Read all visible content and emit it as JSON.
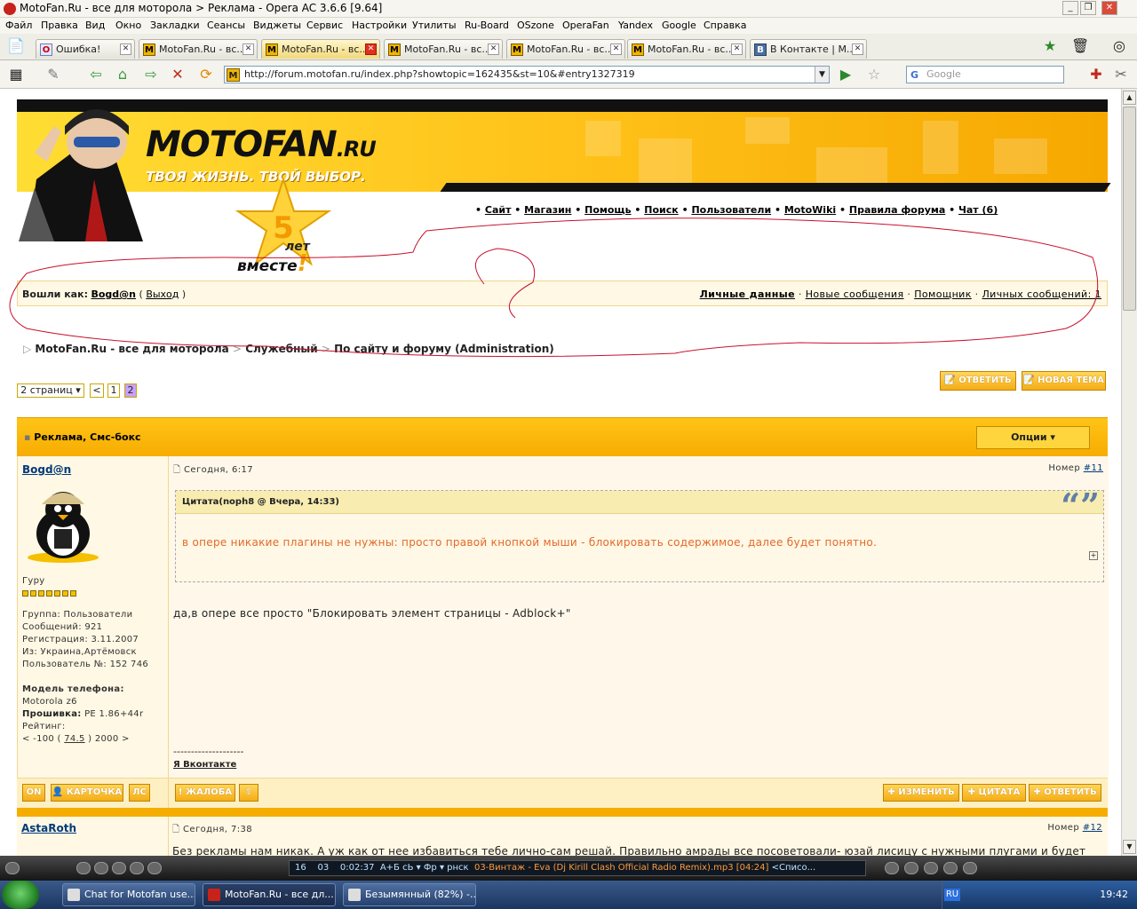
{
  "window": {
    "title": "MotoFan.Ru - все для моторола > Реклама - Opera AC 3.6.6 [9.64]",
    "controls": [
      "_",
      "❐",
      "✕"
    ]
  },
  "menu": [
    "Файл",
    "Правка",
    "Вид",
    "Окно",
    "Закладки",
    "Сеансы",
    "Виджеты",
    "Сервис",
    "Настройки",
    "Утилиты",
    "Ru-Board",
    "OSzone",
    "OperaFan",
    "Yandex",
    "Google",
    "Справка"
  ],
  "tabs": [
    {
      "label": "Ошибка!",
      "favicon": "О"
    },
    {
      "label": "MotoFan.Ru - вс...",
      "favicon": "M"
    },
    {
      "label": "MotoFan.Ru - вс...",
      "favicon": "M"
    },
    {
      "label": "MotoFan.Ru - вс...",
      "favicon": "M"
    },
    {
      "label": "MotoFan.Ru - вс...",
      "favicon": "M"
    },
    {
      "label": "MotoFan.Ru - вс...",
      "favicon": "M"
    },
    {
      "label": "В Контакте | М...",
      "favicon": "B"
    }
  ],
  "address": {
    "url": "http://forum.motofan.ru/index.php?showtopic=162435&st=10&#entry1327319",
    "search_placeholder": "Google",
    "search_engine_letter": "G"
  },
  "banner": {
    "logo_main": "MOTOFAN",
    "logo_ext": ".RU",
    "slogan": "ТВОЯ ЖИЗНЬ. ТВОЙ ВЫБОР.",
    "star_number": "5",
    "anniv_let": "лет",
    "anniv_vmeste": "вместе",
    "anniv_bang": "!"
  },
  "nav": {
    "links": [
      "Сайт",
      "Магазин",
      "Помощь",
      "Поиск",
      "Пользователи",
      "MotoWiki",
      "Правила форума",
      "Чат (6)"
    ]
  },
  "userbar": {
    "logged_as": "Вошли как:",
    "user": "Bogd@n",
    "logout": "Выход",
    "links": [
      "Личные данные",
      "Новые сообщения",
      "Помощник",
      "Личных сообщений: 1"
    ]
  },
  "breadcrumb": [
    "MotoFan.Ru - все для моторола",
    "Служебный",
    "По сайту и форуму (Administration)"
  ],
  "pager": {
    "label": "2 страниц ▾",
    "prev": "<",
    "pages": [
      "1",
      "2"
    ]
  },
  "topic_buttons": {
    "reply": "ОТВЕТИТЬ",
    "new_topic": "НОВАЯ ТЕМА"
  },
  "topic": {
    "title": "Реклама, Смс-бокс",
    "options": "Опции ▾"
  },
  "post1": {
    "author": "Bogd@n",
    "time": "Сегодня, 6:17",
    "number_label": "Номер",
    "number": "#11",
    "rank": "Гуру",
    "info": {
      "group": "Группа: Пользователи",
      "posts": "Сообщений: 921",
      "reg": "Регистрация: 3.11.2007",
      "from": "Из: Украина,Артёмовск",
      "user_no": "Пользователь №: 152 746"
    },
    "phone_label": "Модель телефона:",
    "phone": "Motorola z6",
    "fw_label": "Прошивка:",
    "fw": "PE 1.86+44r",
    "rating_label": "Рейтинг:",
    "rating_left": "< -100 (",
    "rating_value": "74.5",
    "rating_right": ") 2000 >",
    "quote_header": "Цитата(noph8 @ Вчера, 14:33)",
    "quote_text": "в опере никакие плагины не нужны: просто правой кнопкой мыши - блокировать содержимое, далее будет понятно.",
    "text": "да,в опере все просто \"Блокировать элемент страницы - Adblock+\"",
    "signature_line": "--------------------",
    "signature": "Я Вконтакте",
    "buttons_left": [
      "ON",
      "КАРТОЧКА",
      "ЛС"
    ],
    "complaint": "ЖАЛОБА",
    "up": "⇧",
    "buttons_right": [
      "ИЗМЕНИТЬ",
      "ЦИТАТА",
      "ОТВЕТИТЬ"
    ]
  },
  "post2": {
    "author": "AstaRoth",
    "time": "Сегодня, 7:38",
    "number_label": "Номер",
    "number": "#12",
    "text": "Без рекламы нам никак. А уж как от нее избавиться тебе лично-сам решай. Правильно амрады все посоветовали- юзай лисицу с нужными плугами и будет"
  },
  "winamp": {
    "track_no": "16",
    "n2": "03",
    "time": "0:02:37",
    "controls_text": "A+Б сЬ ▾ Фр ▾ рнск",
    "title": "03-Винтаж - Eva (Dj Kirill Clash Official Radio Remix).mp3 [04:24]",
    "extra": "<Списо..."
  },
  "taskbar": {
    "tasks": [
      "Chat for Motofan use...",
      "MotoFan.Ru - все дл...",
      "Безымянный (82%) -..."
    ],
    "lang": "RU",
    "clock": "19:42"
  },
  "colors": {
    "accent": "#f7ac00",
    "link": "#003a7a",
    "quote_text": "#e26a2a",
    "annotation": "#c8102e"
  }
}
